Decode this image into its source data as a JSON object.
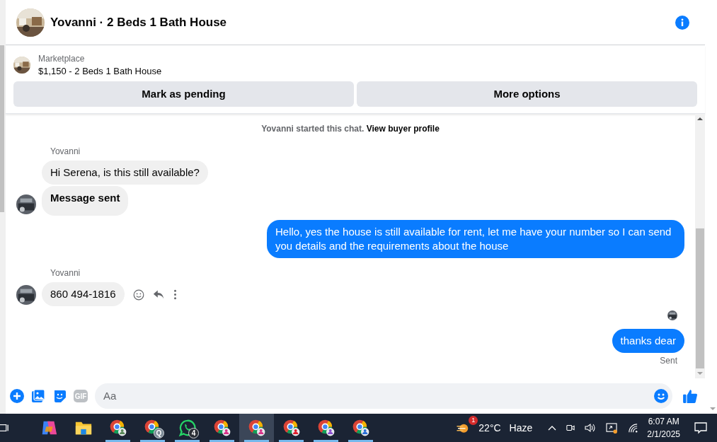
{
  "header": {
    "title": "Yovanni · 2 Beds 1 Bath House"
  },
  "listing": {
    "source": "Marketplace",
    "title": "$1,150 - 2 Beds 1 Bath House",
    "actions": [
      "Mark as pending",
      "More options"
    ]
  },
  "chat": {
    "notice": {
      "text": "Yovanni started this chat.",
      "link": "View buyer profile"
    },
    "messages": [
      {
        "kind": "incoming",
        "sender": "Yovanni",
        "text": "Hi Serena, is this still available?",
        "bold": false,
        "avatar": false,
        "hovered": false
      },
      {
        "kind": "incoming",
        "text": "Message sent",
        "bold": true,
        "avatar": true,
        "hovered": false
      },
      {
        "kind": "outgoing",
        "text": "Hello, yes the house is still available for rent, let me have your number so I can send you details and the requirements about the house",
        "seen": false
      },
      {
        "kind": "incoming",
        "sender": "Yovanni",
        "text": "860 494-1816",
        "bold": false,
        "avatar": true,
        "hovered": true
      },
      {
        "kind": "outgoing",
        "text": "thanks dear",
        "seen": true,
        "status": "Sent"
      }
    ]
  },
  "composer": {
    "gif": "GIF",
    "placeholder": "Aa"
  },
  "taskbar": {
    "apps": [
      {
        "kind": "copilot",
        "running": false,
        "selected": false
      },
      {
        "kind": "folder",
        "running": false,
        "selected": false
      },
      {
        "kind": "chrome",
        "color": "#5a8a5a",
        "running": true,
        "selected": false
      },
      {
        "kind": "chrome",
        "color": "#7c8a96",
        "badge": "Q",
        "running": true,
        "selected": false
      },
      {
        "kind": "whatsapp",
        "badge": "4",
        "running": true,
        "selected": false
      },
      {
        "kind": "chrome",
        "color": "#d9338a",
        "running": true,
        "selected": false
      },
      {
        "kind": "chrome",
        "color": "#d9338a",
        "running": true,
        "selected": true
      },
      {
        "kind": "chrome",
        "color": "#e0202e",
        "running": true,
        "selected": false
      },
      {
        "kind": "chrome",
        "color": "#8a4fd0",
        "running": true,
        "selected": false
      },
      {
        "kind": "chrome",
        "color": "#2a6fd6",
        "running": true,
        "selected": false
      }
    ],
    "weather": {
      "badge": "1",
      "temp": "22°C",
      "condition": "Haze"
    },
    "time": "6:07 AM",
    "date": "2/1/2025"
  }
}
